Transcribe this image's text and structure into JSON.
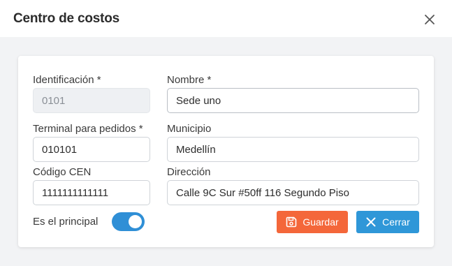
{
  "dialog": {
    "title": "Centro de costos"
  },
  "form": {
    "identificacion_label": "Identificación *",
    "identificacion_value": "0101",
    "nombre_label": "Nombre *",
    "nombre_value": "Sede uno",
    "terminal_label": "Terminal para pedidos *",
    "terminal_value": "010101",
    "municipio_label": "Municipio",
    "municipio_value": "Medellín",
    "codigo_label": "Código CEN",
    "codigo_value": "1111111111111",
    "direccion_label": "Dirección",
    "direccion_value": "Calle 9C Sur #50ff 116 Segundo Piso",
    "principal_label": "Es el principal",
    "principal_on": true
  },
  "actions": {
    "save_label": "Guardar",
    "close_label": "Cerrar"
  },
  "colors": {
    "save": "#f4673a",
    "close": "#2f97d8",
    "toggle": "#2f8fd6"
  },
  "icons": {
    "dialog_close": "close-icon",
    "save": "floppy-disk-icon",
    "close": "x-icon"
  }
}
